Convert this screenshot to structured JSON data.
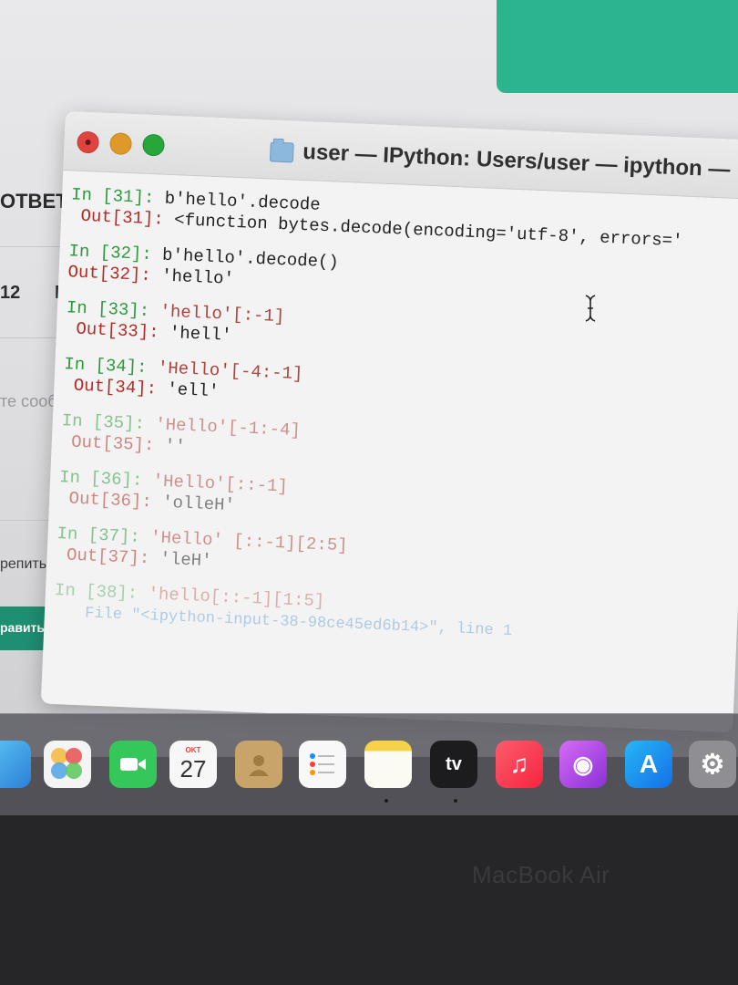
{
  "background": {
    "reply_label": "ОТВЕТ",
    "list_number": "12",
    "list_letter": "Н:",
    "write_placeholder": "те сообщ",
    "attach_label": "репить фа",
    "send_button": "равить на п"
  },
  "terminal": {
    "title": "user — IPython: Users/user — ipython —",
    "entries": [
      {
        "in_prompt": "In [31]:",
        "in_code": "b'hello'.decode",
        "out_prompt": "Out[31]:",
        "out_value": "<function bytes.decode(encoding='utf-8', errors='"
      },
      {
        "in_prompt": "In [32]:",
        "in_code": "b'hello'.decode()",
        "out_prompt": "Out[32]:",
        "out_value": "'hello'"
      },
      {
        "in_prompt": "In [33]:",
        "in_code": "'hello'[:-1]",
        "out_prompt": "Out[33]:",
        "out_value": "'hell'"
      },
      {
        "in_prompt": "In [34]:",
        "in_code": "'Hello'[-4:-1]",
        "out_prompt": "Out[34]:",
        "out_value": "'ell'"
      },
      {
        "in_prompt": "In [35]:",
        "in_code": "'Hello'[-1:-4]",
        "out_prompt": "Out[35]:",
        "out_value": "''"
      },
      {
        "in_prompt": "In [36]:",
        "in_code": "'Hello'[::-1]",
        "out_prompt": "Out[36]:",
        "out_value": "'olleH'"
      },
      {
        "in_prompt": "In [37]:",
        "in_code": "'Hello' [::-1][2:5]",
        "out_prompt": "Out[37]:",
        "out_value": "'leH'"
      },
      {
        "in_prompt": "In [38]:",
        "in_code": "'hello[::-1][1:5]",
        "trace": "File \"<ipython-input-38-98ce45ed6b14>\", line 1"
      }
    ]
  },
  "dock": {
    "calendar_month": "OKT",
    "calendar_day": "27",
    "tv_label": "tv",
    "icons": [
      "finder-icon",
      "photos-icon",
      "facetime-icon",
      "calendar-icon",
      "contacts-icon",
      "reminders-icon",
      "notes-icon",
      "tv-icon",
      "music-icon",
      "podcasts-icon",
      "app-store-icon",
      "system-preferences-icon"
    ]
  },
  "device": {
    "brand": "MacBook Air"
  }
}
